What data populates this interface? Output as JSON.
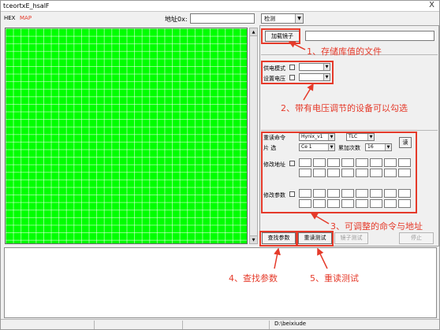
{
  "window": {
    "title": "tceortxE_hsalF",
    "close_glyph": "X"
  },
  "toolbar": {
    "hex_label": "HEX",
    "map_label": "MAP",
    "address_label": "地址0x:",
    "address_value": "",
    "detect_value": "检测",
    "hex_color": "#000000",
    "map_color": "#e53a2a"
  },
  "grid": {
    "fill_color": "#00ff00"
  },
  "load": {
    "button_label": "加载镜子",
    "path_value": ""
  },
  "power": {
    "supply_mode_label": "供电模式",
    "set_voltage_label": "设置电压",
    "supply_mode_value": "",
    "set_voltage_value": ""
  },
  "reread": {
    "command_label": "重读命令",
    "command_value": "Hynix_v1",
    "tlc_value": "TLC",
    "chip_label": "片    选",
    "chip_value": "Ce 1",
    "accumulate_label": "累加次数",
    "accumulate_value": "16",
    "read_button_label": "读",
    "modify_address_label": "修改地址",
    "modify_param_label": "修改参数"
  },
  "actions": {
    "find_param_label": "查找参数",
    "reread_test_label": "重读测试",
    "mirror_test_label": "镜子测试",
    "stop_label": "停止"
  },
  "annotations": {
    "note_1": "1、存储库值的文件",
    "note_2": "2、带有电压调节的设备可以勾选",
    "note_3": "3、可调整的命令与地址",
    "note_4": "4、查找参数",
    "note_5": "5、重读测试",
    "color": "#e53a2a"
  },
  "statusbar": {
    "path": "D:\\beixiude"
  }
}
